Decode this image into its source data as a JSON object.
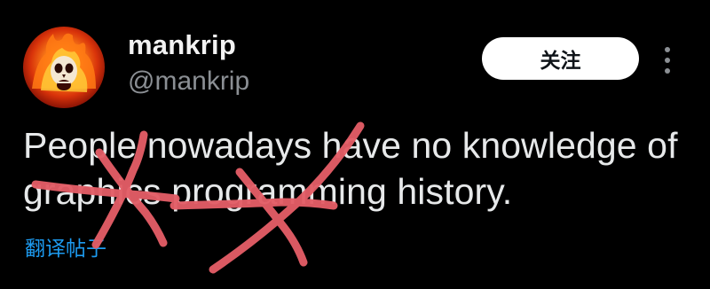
{
  "tweet": {
    "author": {
      "display_name": "mankrip",
      "handle": "@mankrip",
      "avatar_icon": "flaming-skull-avatar-icon"
    },
    "follow_label": "关注",
    "more_icon": "more-vertical-icon",
    "text": "People nowadays have no knowledge of graphics programming history.",
    "translate_label": "翻译帖子"
  },
  "colors": {
    "background": "#000000",
    "text": "#e7e9ea",
    "handle": "#8b8f94",
    "link": "#1d9bf0",
    "follow_bg": "#ffffff",
    "scribble": "#e35d66"
  }
}
